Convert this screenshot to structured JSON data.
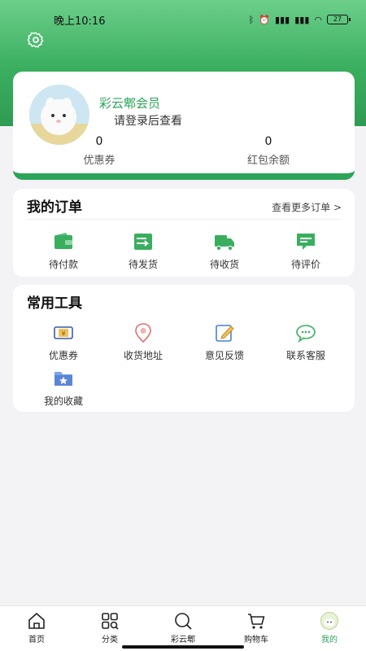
{
  "status": {
    "time": "晚上10:16",
    "battery": "27"
  },
  "profile": {
    "member_name": "彩云郫会员",
    "login_hint": "请登录后查看",
    "coupon_count": "0",
    "coupon_label": "优惠券",
    "redpacket_count": "0",
    "redpacket_label": "红包余额"
  },
  "orders": {
    "title": "我的订单",
    "more": "查看更多订单 >",
    "items": [
      {
        "label": "待付款",
        "icon": "wallet-icon"
      },
      {
        "label": "待发货",
        "icon": "send-card-icon"
      },
      {
        "label": "待收货",
        "icon": "truck-icon"
      },
      {
        "label": "待评价",
        "icon": "comment-icon"
      }
    ]
  },
  "tools": {
    "title": "常用工具",
    "items": [
      {
        "label": "优惠券",
        "icon": "coupon-icon"
      },
      {
        "label": "收货地址",
        "icon": "location-icon"
      },
      {
        "label": "意见反馈",
        "icon": "edit-icon"
      },
      {
        "label": "联系客服",
        "icon": "chat-icon"
      },
      {
        "label": "我的收藏",
        "icon": "folder-star-icon"
      }
    ]
  },
  "tabbar": {
    "items": [
      {
        "label": "首页",
        "icon": "home-icon"
      },
      {
        "label": "分类",
        "icon": "grid-icon"
      },
      {
        "label": "彩云郫",
        "icon": "search-icon"
      },
      {
        "label": "购物车",
        "icon": "cart-icon"
      },
      {
        "label": "我的",
        "icon": "profile-icon"
      }
    ],
    "active_index": 4
  },
  "colors": {
    "brand": "#2ca55a",
    "accent_green": "#3aae5f",
    "coupon_gold": "#d8a440",
    "location_red": "#e07070",
    "edit_blue": "#4a7fd6"
  }
}
